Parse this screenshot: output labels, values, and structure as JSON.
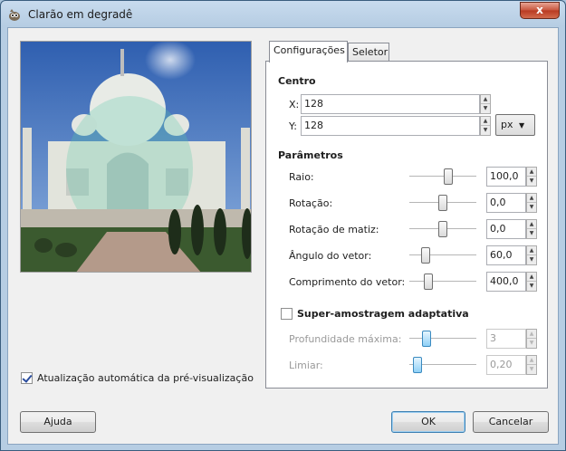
{
  "window": {
    "title": "Clarão em degradê",
    "close_symbol": "x"
  },
  "preview": {
    "auto_update_label": "Atualização automática da pré-visualização",
    "auto_update_checked": true
  },
  "tabs": [
    {
      "label": "Configurações",
      "active": true
    },
    {
      "label": "Seletor",
      "active": false
    }
  ],
  "centro": {
    "title": "Centro",
    "x_label": "X:",
    "x_value": "128",
    "y_label": "Y:",
    "y_value": "128",
    "unit": "px"
  },
  "parametros": {
    "title": "Parâmetros",
    "items": [
      {
        "label": "Raio:",
        "value": "100,0",
        "level": 0.6
      },
      {
        "label": "Rotação:",
        "value": "0,0",
        "level": 0.5
      },
      {
        "label": "Rotação de matiz:",
        "value": "0,0",
        "level": 0.5
      },
      {
        "label": "Ângulo do vetor:",
        "value": "60,0",
        "level": 0.2
      },
      {
        "label": "Comprimento do vetor:",
        "value": "400,0",
        "level": 0.25
      }
    ]
  },
  "supersampling": {
    "label": "Super-amostragem adaptativa",
    "checked": false,
    "items": [
      {
        "label": "Profundidade máxima:",
        "value": "3",
        "level": 0.22
      },
      {
        "label": "Limiar:",
        "value": "0,20",
        "level": 0.06
      }
    ]
  },
  "buttons": {
    "help": "Ajuda",
    "ok": "OK",
    "cancel": "Cancelar"
  },
  "colors": {
    "accent": "#3c7fb1",
    "disabled_text": "#9a9a9a"
  }
}
